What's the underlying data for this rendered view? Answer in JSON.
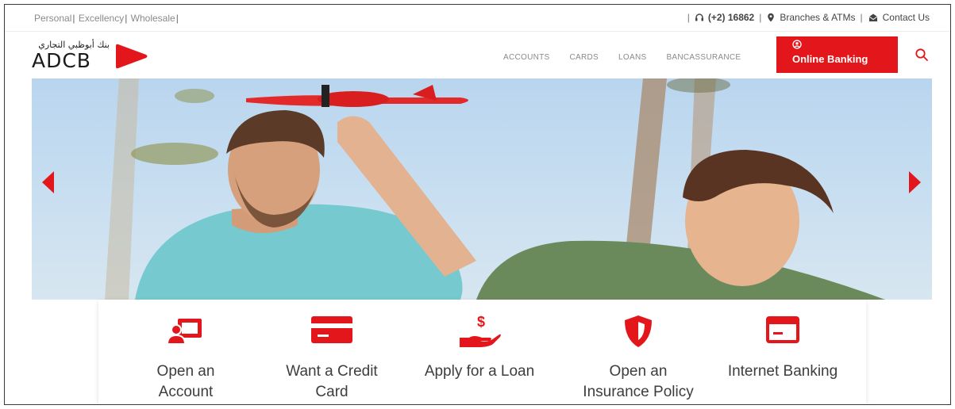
{
  "topbar": {
    "links": [
      "Personal",
      "Excellency",
      "Wholesale"
    ],
    "phone": "(+2) 16862",
    "branches": "Branches & ATMs",
    "contact": "Contact Us"
  },
  "logo": {
    "arabic": "بنك أبوظبي التجاري",
    "text": "ADCB"
  },
  "nav": {
    "items": [
      "ACCOUNTS",
      "CARDS",
      "LOANS",
      "BANCASSURANCE"
    ],
    "online_banking": "Online Banking"
  },
  "hero": {
    "prev_icon": "chevron-left-icon",
    "next_icon": "chevron-right-icon"
  },
  "quick_links": [
    {
      "line1": "Open an",
      "line2": "Account",
      "icon": "account-icon"
    },
    {
      "line1": "Want a Credit",
      "line2": "Card",
      "icon": "credit-card-icon"
    },
    {
      "line1": "Apply for a Loan",
      "line2": "",
      "icon": "loan-hand-icon"
    },
    {
      "line1": "Open an",
      "line2": "Insurance Policy",
      "icon": "shield-icon"
    },
    {
      "line1": "Internet Banking",
      "line2": "",
      "icon": "internet-banking-icon"
    }
  ],
  "colors": {
    "accent": "#e3171b",
    "text": "#3d3d3d",
    "muted": "#8a8a8a"
  }
}
